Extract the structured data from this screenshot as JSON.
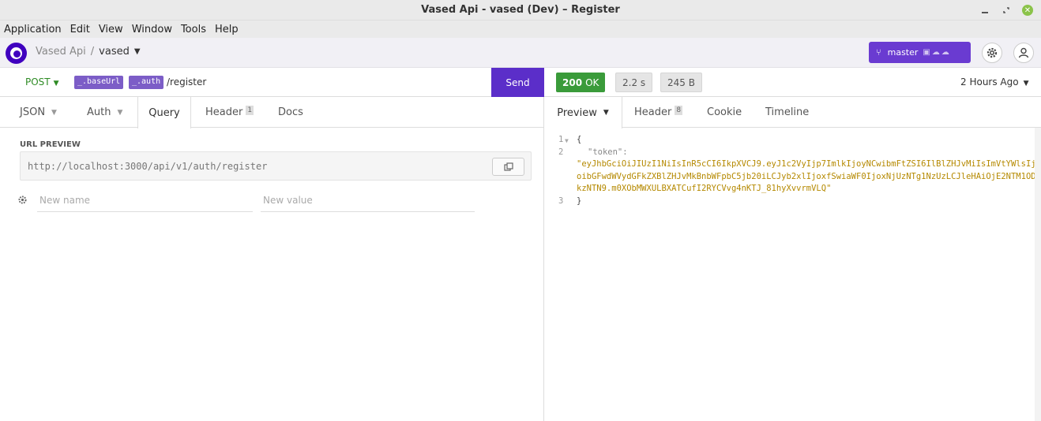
{
  "window": {
    "title": "Vased Api - vased (Dev) – Register"
  },
  "menu": [
    "Application",
    "Edit",
    "View",
    "Window",
    "Tools",
    "Help"
  ],
  "breadcrumb": {
    "workspace": "Vased Api",
    "separator": "/",
    "collection": "vased"
  },
  "branch": {
    "name": "master"
  },
  "request": {
    "method": "POST",
    "base_tag": "_.baseUrl",
    "auth_tag": "_.auth",
    "path": "/register",
    "send_label": "Send",
    "tabs": [
      {
        "label": "JSON"
      },
      {
        "label": "Auth"
      },
      {
        "label": "Query"
      },
      {
        "label": "Header",
        "count": "1"
      },
      {
        "label": "Docs"
      }
    ],
    "url_preview_label": "URL PREVIEW",
    "url_preview": "http://localhost:3000/api/v1/auth/register",
    "param_name_placeholder": "New name",
    "param_value_placeholder": "New value"
  },
  "response": {
    "status_code": "200",
    "status_text": "OK",
    "time": "2.2 s",
    "size": "245 B",
    "history": "2 Hours Ago",
    "tabs": [
      {
        "label": "Preview"
      },
      {
        "label": "Header",
        "count": "8"
      },
      {
        "label": "Cookie"
      },
      {
        "label": "Timeline"
      }
    ],
    "lines": [
      {
        "num": "1",
        "text": "{"
      },
      {
        "num": "2",
        "key": "\"token\":",
        "value": "\"eyJhbGciOiJIUzI1NiIsInR5cCI6IkpXVCJ9.eyJ1c2VyIjp7ImlkIjoyNCwibmFtZSI6IlBlZHJvMiIsImVtYWlsIjoibGFwdWVydGFkZXBlZHJvMkBnbWFpbC5jb20iLCJyb2xlIjoxfSwiaWF0IjoxNjUzNTg1NzUzLCJleHAiOjE2NTM1ODkzNTN9.m0XObMWXULBXATCufI2RYCVvg4nKTJ_81hyXvvrmVLQ\""
      },
      {
        "num": "3",
        "text": "}"
      }
    ]
  }
}
